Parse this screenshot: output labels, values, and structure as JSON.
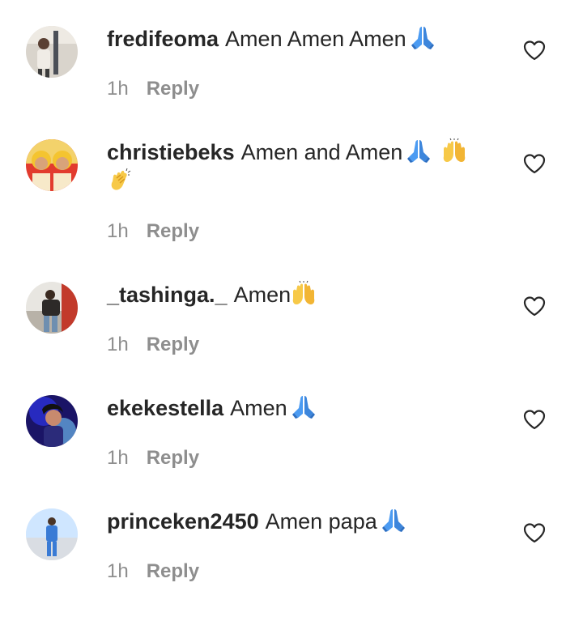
{
  "comments": [
    {
      "username": "fredifeoma",
      "text": "Amen Amen Amen",
      "emojis": [
        "folded-hands-emoji"
      ],
      "time": "1h",
      "reply_label": "Reply",
      "avatar_colors": [
        "#d9d4cc",
        "#4b4f57",
        "#f0ece6"
      ]
    },
    {
      "username": "christiebeks",
      "text": "Amen and Amen",
      "emojis": [
        "folded-hands-emoji",
        "raising-hands-emoji",
        "clapping-hands-emoji"
      ],
      "time": "1h",
      "reply_label": "Reply",
      "avatar_colors": [
        "#f4c430",
        "#e23b2e",
        "#f7e9c9"
      ]
    },
    {
      "username": "_tashinga._",
      "text": "Amen",
      "emojis": [
        "raising-hands-emoji"
      ],
      "time": "1h",
      "reply_label": "Reply",
      "avatar_colors": [
        "#e8e6e1",
        "#2d2a28",
        "#b8b2a8"
      ]
    },
    {
      "username": "ekekestella",
      "text": "Amen",
      "emojis": [
        "folded-hands-emoji"
      ],
      "time": "1h",
      "reply_label": "Reply",
      "avatar_colors": [
        "#2a2fd6",
        "#7ad0ff",
        "#1a1466"
      ]
    },
    {
      "username": "princeken2450",
      "text": "Amen papa",
      "emojis": [
        "folded-hands-emoji"
      ],
      "time": "1h",
      "reply_label": "Reply",
      "avatar_colors": [
        "#cfe6ff",
        "#3a7bd5",
        "#f2f2f2"
      ]
    }
  ],
  "icons": {
    "like": "heart-outline-icon"
  },
  "colors": {
    "text": "#262626",
    "meta": "#8e8e8e",
    "background": "#ffffff"
  }
}
